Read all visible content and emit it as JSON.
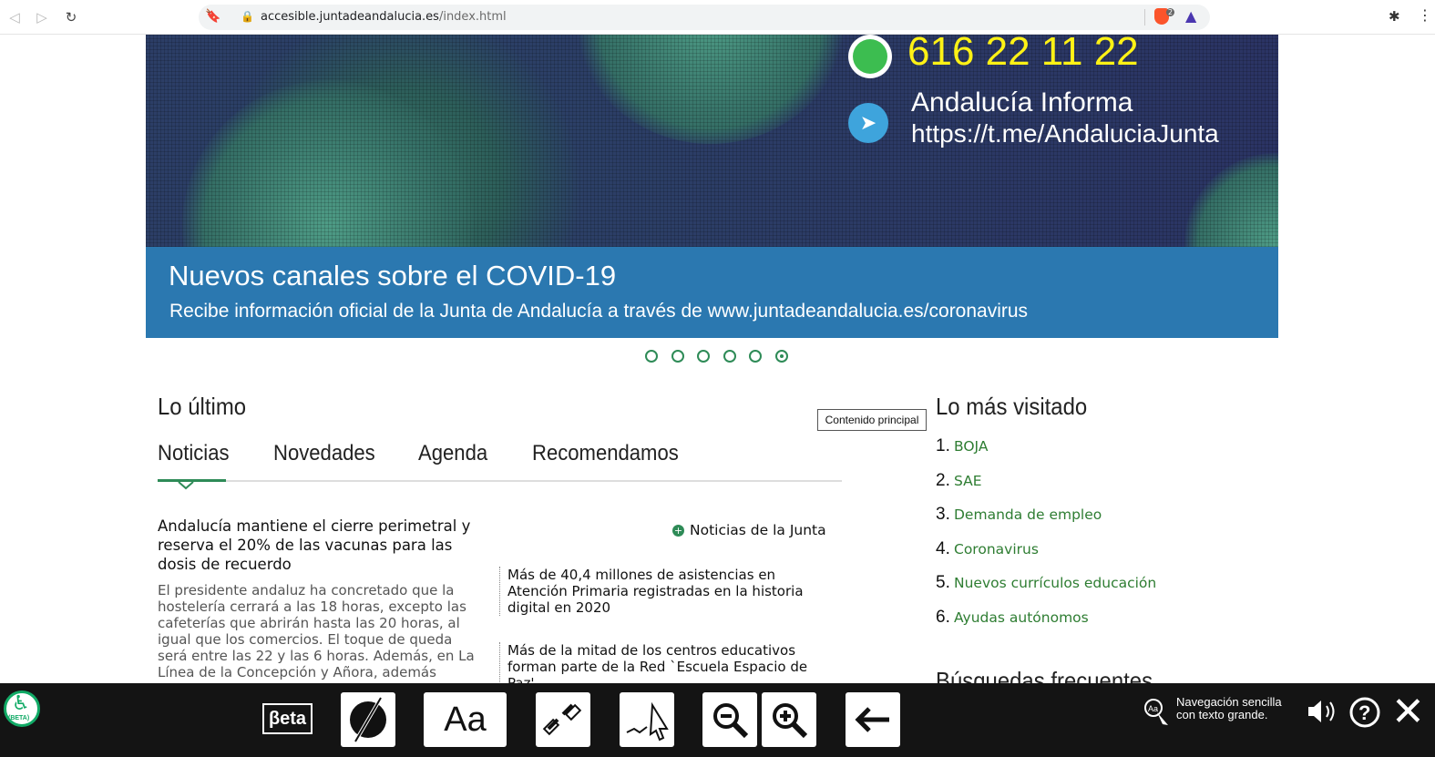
{
  "browser": {
    "url_host": "accesible.juntadeandalucia.es",
    "url_path": "/index.html",
    "brave_badge": "2"
  },
  "banner": {
    "phone": "616 22 11 22",
    "channel_name": "Andalucía Informa",
    "channel_url": "https://t.me/AndaluciaJunta",
    "caption_title": "Nuevos canales sobre el COVID-19",
    "caption_subtitle": "Recibe información oficial de la Junta de Andalucía a través de www.juntadeandalucia.es/coronavirus",
    "slide_count": 6,
    "active_slide": 6
  },
  "latest": {
    "heading": "Lo último",
    "tabs": [
      "Noticias",
      "Novedades",
      "Agenda",
      "Recomendamos"
    ],
    "active_tab": "Noticias",
    "tooltip": "Contenido principal",
    "main_title": "Andalucía mantiene el cierre perimetral y reserva el 20% de las vacunas para las dosis de recuerdo",
    "main_body": "El presidente andaluz ha concretado que la hostelería cerrará a las 18 horas, excepto las cafeterías que abrirán hasta las 20 horas, al igual que los comercios. El toque de queda será entre las 22 y las 6 horas. Además, en La Línea de la Concepción y Añora, además",
    "junta_link": "Noticias de la Junta",
    "side_items": [
      "Más de 40,4 millones de asistencias en Atención Primaria registradas en la historia digital en 2020",
      "Más de la mitad de los centros educativos forman parte de la Red `Escuela Espacio de Paz'"
    ]
  },
  "most_visited": {
    "heading": "Lo más visitado",
    "items": [
      "BOJA",
      "SAE",
      "Demanda de empleo",
      "Coronavirus",
      "Nuevos currículos educación",
      "Ayudas autónomos"
    ],
    "numbers": [
      "1.",
      "2.",
      "3.",
      "4.",
      "5.",
      "6."
    ]
  },
  "frequent": {
    "heading": "Búsquedas frecuentes"
  },
  "toolbar": {
    "beta_label": "βeta",
    "logo_label": "(BETA)",
    "font_label": "Aa",
    "nav_text": "Navegación sencilla con texto grande.",
    "close_label": "✕"
  },
  "colors": {
    "accent": "#2e8b57",
    "caption_bg": "#2b78b0",
    "phone": "#fff215",
    "toolbar_bg": "#141414"
  }
}
